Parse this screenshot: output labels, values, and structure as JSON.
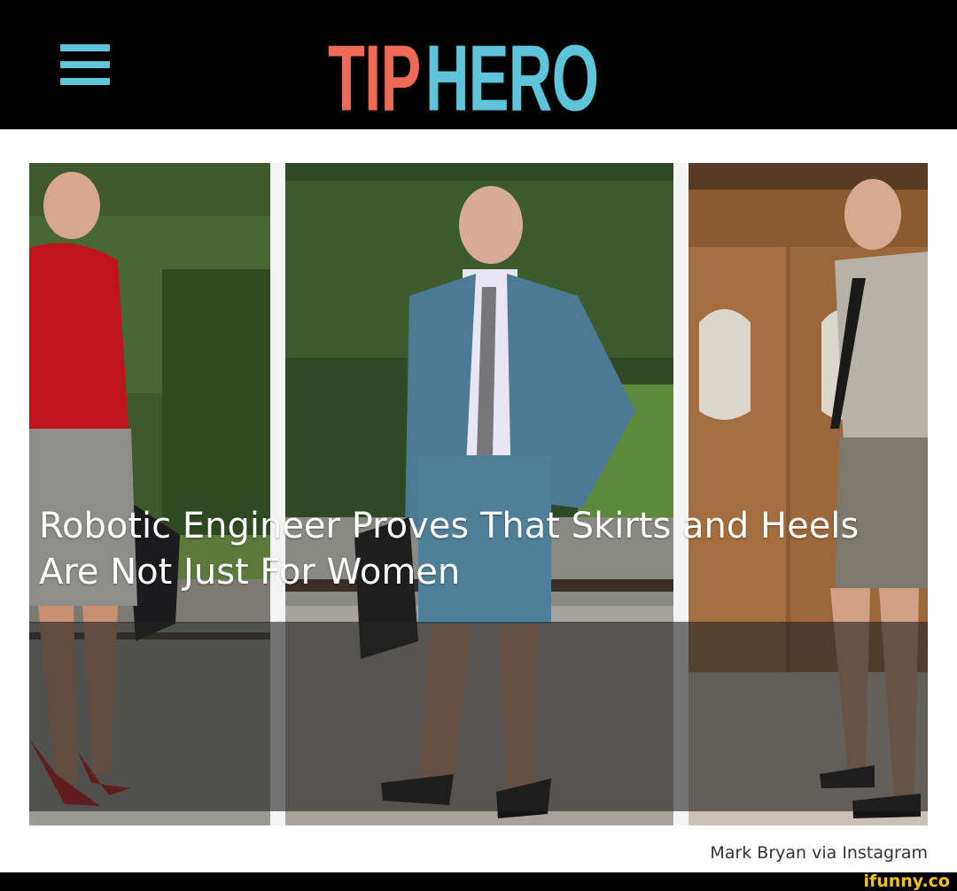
{
  "header": {
    "menu_icon": "hamburger-menu-icon",
    "logo_part1": "TIP",
    "logo_part2": "HERO",
    "colors": {
      "background": "#000000",
      "logo_tip": "#ef6a55",
      "logo_hero": "#5ec4d9",
      "menu": "#5ec4d9"
    }
  },
  "article": {
    "headline": "Robotic Engineer Proves That Skirts and Heels Are Not Just For Women",
    "photo_credit": "Mark Bryan via Instagram",
    "photos": [
      "outfit-photo-red-shirt",
      "outfit-photo-blue-suit",
      "outfit-photo-grey-shirt"
    ]
  },
  "watermark": {
    "text": "ifunny.co",
    "color": "#f3c316"
  }
}
